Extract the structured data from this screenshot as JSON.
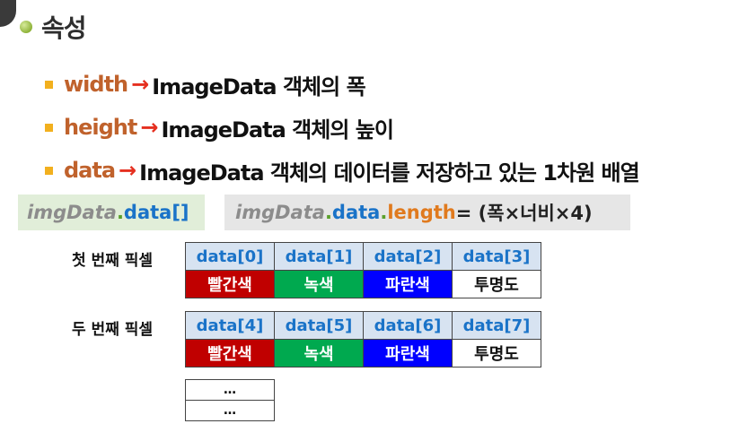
{
  "title": "속성",
  "properties": [
    {
      "name": "width",
      "arrow": "→",
      "desc": "ImageData 객체의 폭"
    },
    {
      "name": "height",
      "arrow": "→",
      "desc": "ImageData 객체의 높이"
    },
    {
      "name": "data",
      "arrow": "→",
      "desc": "ImageData 객체의 데이터를 저장하고 있는 1차원 배열"
    }
  ],
  "code_left": {
    "obj": "imgData",
    "dot": ".",
    "prop": "data[]"
  },
  "code_right": {
    "obj": "imgData",
    "dot1": ".",
    "prop": "data",
    "dot2": ".",
    "len": "length",
    "rest": " = (폭×너비×4)"
  },
  "pixels": [
    {
      "label": "첫 번째 픽셀",
      "headers": [
        "data[0]",
        "data[1]",
        "data[2]",
        "data[3]"
      ],
      "channels": [
        "빨간색",
        "녹색",
        "파란색",
        "투명도"
      ]
    },
    {
      "label": "두 번째 픽셀",
      "headers": [
        "data[4]",
        "data[5]",
        "data[6]",
        "data[7]"
      ],
      "channels": [
        "빨간색",
        "녹색",
        "파란색",
        "투명도"
      ]
    }
  ],
  "ellipsis": [
    "…",
    "…"
  ],
  "colors": {
    "red": "#c00000",
    "green": "#00a94f",
    "blue": "#0000ff",
    "header_bg": "#d7e3f1",
    "keyword": "#c0622c",
    "arrow": "#e53020"
  }
}
